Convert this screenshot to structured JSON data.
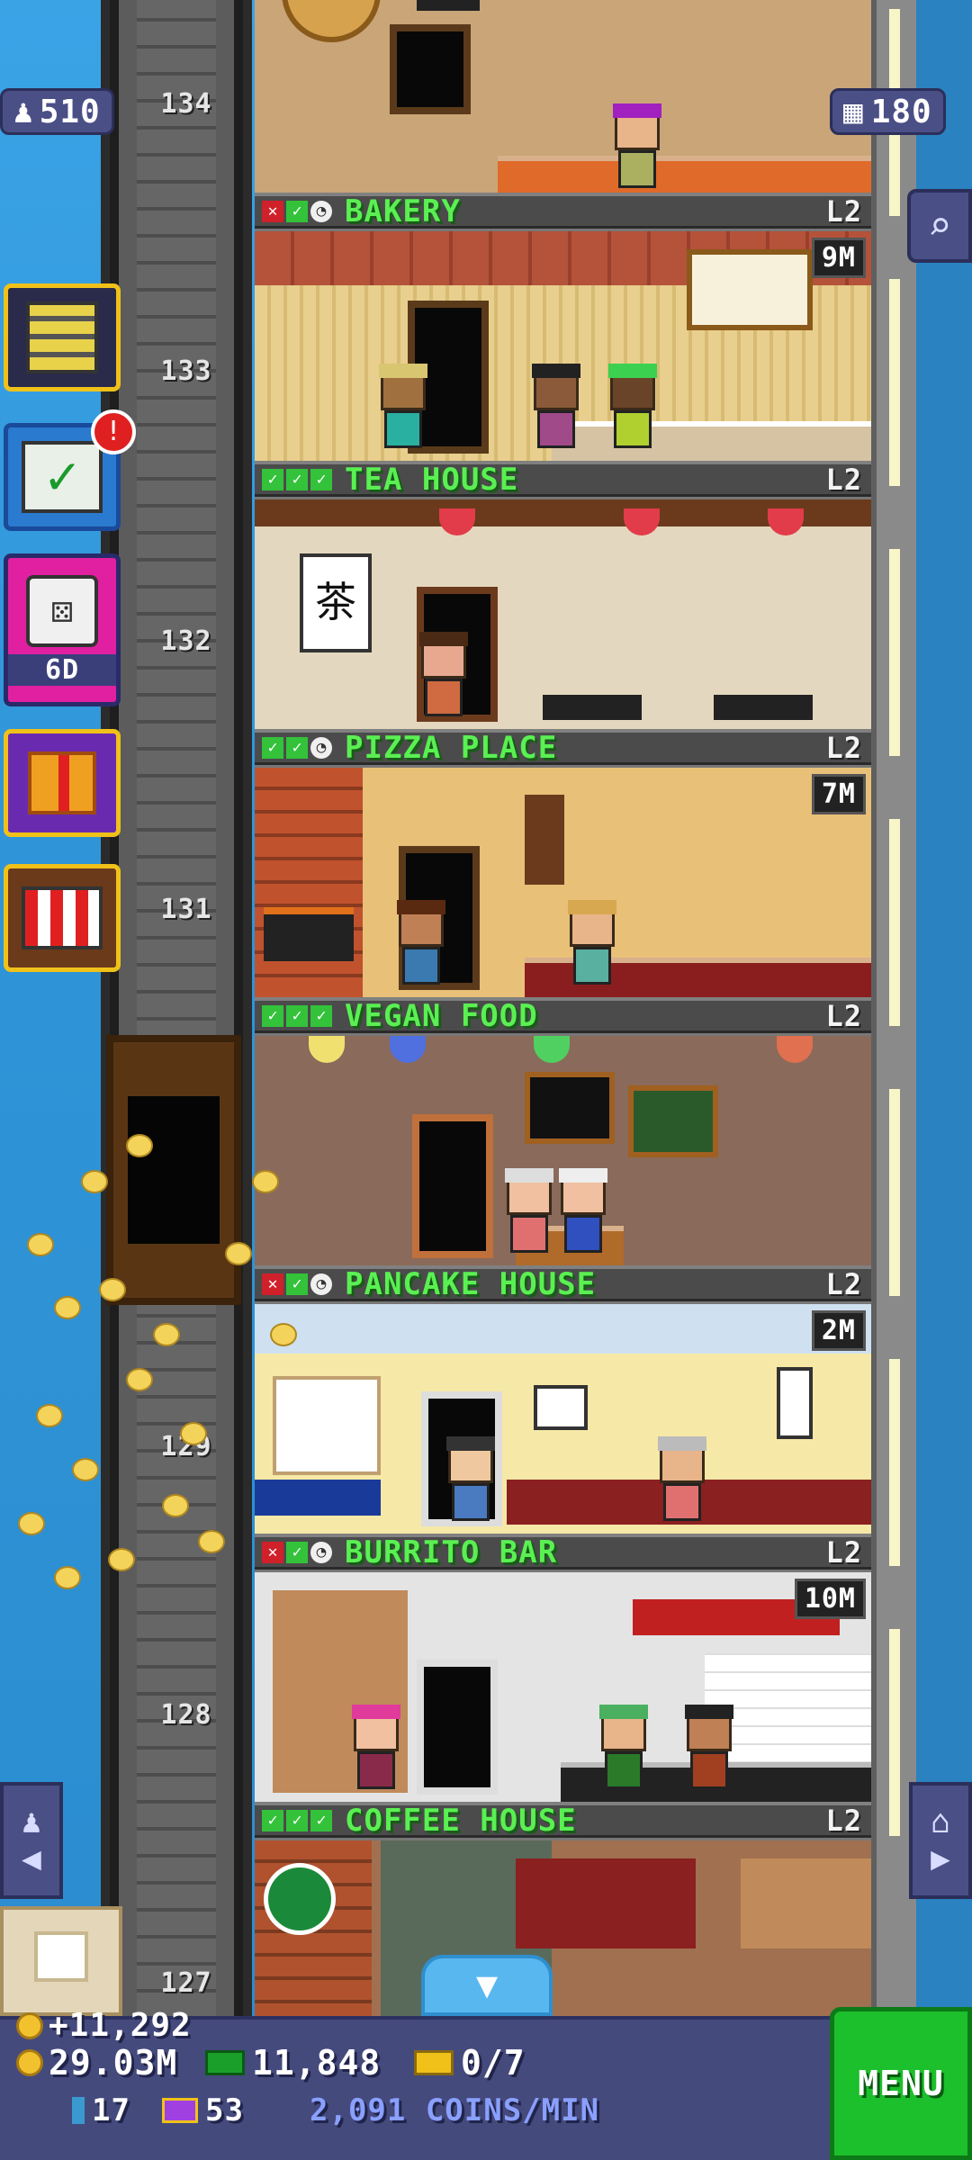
{
  "header": {
    "population": "510",
    "floors": "180"
  },
  "shaft": {
    "floor_numbers": [
      "134",
      "133",
      "132",
      "131",
      "129",
      "128",
      "127"
    ]
  },
  "side_buttons": {
    "dice_label": "6D",
    "notification_badge": "!"
  },
  "rooms": [
    {
      "name": "BAKERY",
      "level": "L2",
      "stock": "",
      "checks": [
        "no",
        "ok",
        "clock"
      ]
    },
    {
      "name": "TEA HOUSE",
      "level": "L2",
      "stock": "9M",
      "checks": [
        "ok",
        "ok",
        "ok"
      ]
    },
    {
      "name": "PIZZA PLACE",
      "level": "L2",
      "stock": "",
      "checks": [
        "ok",
        "ok",
        "clock"
      ]
    },
    {
      "name": "VEGAN FOOD",
      "level": "L2",
      "stock": "7M",
      "checks": [
        "ok",
        "ok",
        "ok"
      ]
    },
    {
      "name": "PANCAKE HOUSE",
      "level": "L2",
      "stock": "",
      "checks": [
        "no",
        "ok",
        "clock"
      ]
    },
    {
      "name": "BURRITO BAR",
      "level": "L2",
      "stock": "2M",
      "checks": [
        "no",
        "ok",
        "clock"
      ]
    },
    {
      "name": "COFFEE HOUSE",
      "level": "L2",
      "stock": "10M",
      "checks": [
        "ok",
        "ok",
        "ok"
      ]
    }
  ],
  "bottom": {
    "coin_gain": "+11,292",
    "coins": "29.03M",
    "bux": "11,848",
    "vip": "0/7",
    "tickets": "17",
    "golden": "53",
    "rate": "2,091 COINS/MIN",
    "menu_label": "MENU"
  },
  "colors": {
    "sky": "#2f95d8",
    "room_name": "#5af052",
    "menu": "#1cbf2c",
    "bottom_bar": "#454a7d"
  }
}
